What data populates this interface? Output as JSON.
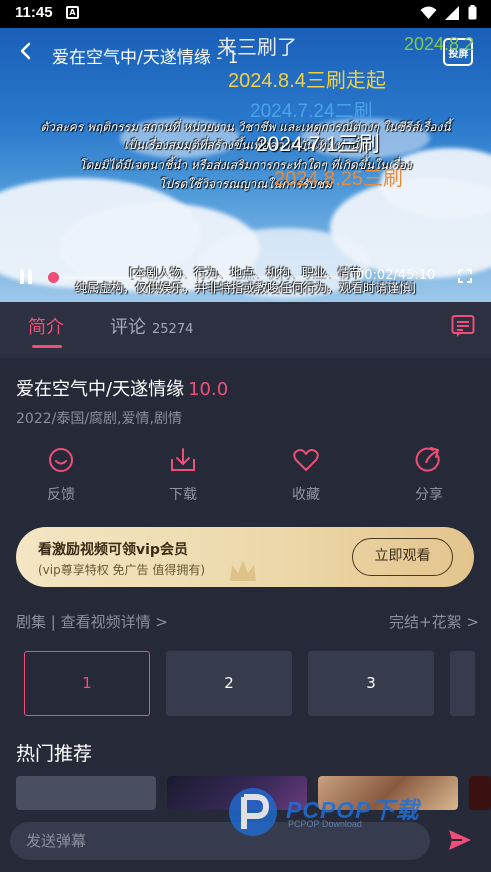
{
  "status_bar": {
    "time": "11:45",
    "notification_badge": "A",
    "icons": [
      "wifi-icon",
      "signal-icon",
      "battery-icon"
    ]
  },
  "player": {
    "title": "爱在空气中/天遂情缘 - 1",
    "cast_label": "投屏",
    "time_label": "00:02/45:10",
    "progress_fraction": 0.00074,
    "danmaku": [
      {
        "text": "来三刷了",
        "color": "#e8e8e8"
      },
      {
        "text": "2024.8.2",
        "color": "#7fc84a"
      },
      {
        "text": "2024.8.4三刷走起",
        "color": "#f4d03f"
      },
      {
        "text": "2024.7.24二刷",
        "color": "#4aa3e8"
      },
      {
        "text": "2024.7.1三刷",
        "color": "#ffffff"
      },
      {
        "text": "2024.8.25三刷",
        "color": "#e88b3a"
      }
    ],
    "thai_lines": [
      "ตัวละคร พฤติกรรม สถานที่ หน่วยงาน วิชาชีพ และเหตุการณ์ต่างๆ ในซีรีส์เรื่องนี้",
      "เป็นเรื่องสมมุติที่สร้างขึ้นเพื่อความบันเทิงเท่านั้น",
      "โดยมิได้มีเจตนาชี้นำ หรือส่งเสริมการกระทำใดๆ ที่เกิดขึ้นในเรื่อง",
      "โปรดใช้วิจารณญาณในการรับชม"
    ],
    "disclaimer_lines": [
      "[本剧人物、行为、地点、机构、职业、情节",
      "纯属虚构，仅供娱乐，并非特指或教唆任何行为，观看时请谨慎]"
    ]
  },
  "tabs": [
    {
      "label": "简介",
      "active": true
    },
    {
      "label": "评论",
      "count": "25274",
      "active": false
    }
  ],
  "show": {
    "title": "爱在空气中/天遂情缘",
    "score": "10.0",
    "meta": "2022/泰国/腐剧,爱情,剧情"
  },
  "actions": [
    {
      "label": "反馈",
      "icon": "feedback-icon"
    },
    {
      "label": "下载",
      "icon": "download-icon"
    },
    {
      "label": "收藏",
      "icon": "heart-icon"
    },
    {
      "label": "分享",
      "icon": "share-icon"
    }
  ],
  "vip_banner": {
    "title": "看激励视频可领vip会员",
    "subtitle": "(vip尊享特权 免广告 值得拥有)",
    "button": "立即观看"
  },
  "episodes": {
    "header": "剧集 | 查看视频详情 >",
    "status": "完结+花絮 >",
    "items": [
      "1",
      "2",
      "3"
    ]
  },
  "hot": {
    "title": "热门推荐"
  },
  "input": {
    "placeholder": "发送弹幕"
  },
  "watermark": {
    "logo": "PCPOP下载",
    "sub": "PCPOP Download"
  },
  "colors": {
    "accent": "#f04e78",
    "background": "#262a38",
    "card": "#363b4d"
  }
}
